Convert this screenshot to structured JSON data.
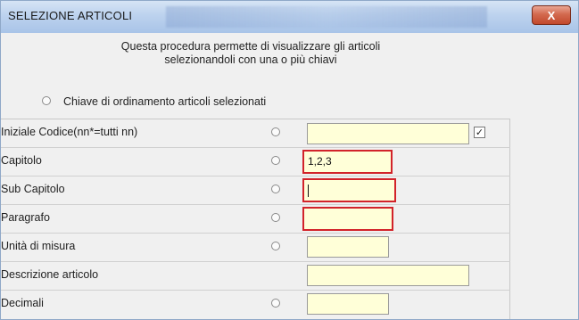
{
  "window": {
    "title": "SELEZIONE ARTICOLI",
    "close_label": "X"
  },
  "intro": {
    "line1": "Questa procedura permette di visualizzare gli articoli",
    "line2": "selezionandoli con una o più chiavi"
  },
  "sort_option": {
    "label": "Chiave di ordinamento articoli selezionati"
  },
  "rows": [
    {
      "label": "Iniziale Codice(nn*=tutti nn)",
      "value": "",
      "checkbox_checked": true
    },
    {
      "label": "Capitolo",
      "value": "1,2,3"
    },
    {
      "label": "Sub Capitolo",
      "value": ""
    },
    {
      "label": "Paragrafo",
      "value": ""
    },
    {
      "label": "Unità di misura",
      "value": ""
    },
    {
      "label": "Descrizione articolo",
      "value": ""
    },
    {
      "label": "Decimali",
      "value": ""
    }
  ],
  "checkbox_glyph": "✓"
}
